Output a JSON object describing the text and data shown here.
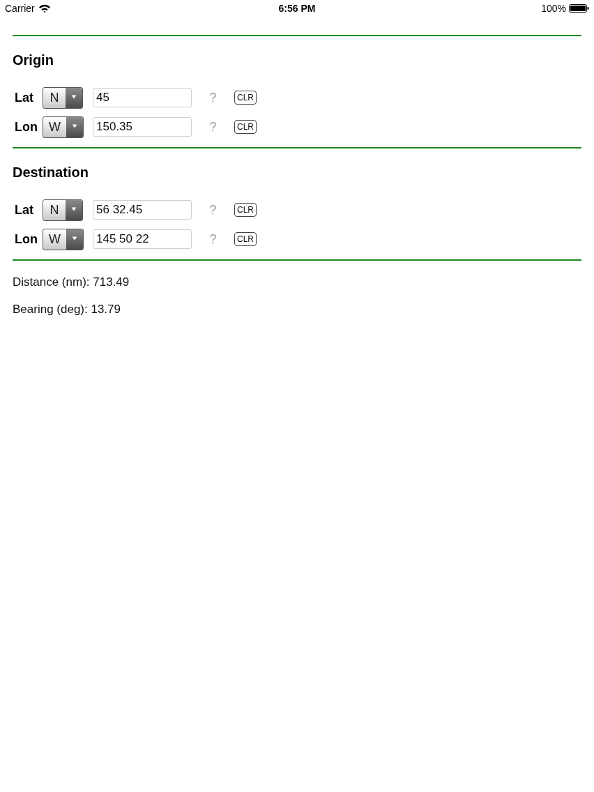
{
  "status_bar": {
    "carrier": "Carrier",
    "time": "6:56 PM",
    "battery": "100%"
  },
  "sections": [
    {
      "title": "Origin",
      "rows": [
        {
          "label": "Lat",
          "hemisphere": "N",
          "value": "45",
          "help": "?",
          "clear": "CLR"
        },
        {
          "label": "Lon",
          "hemisphere": "W",
          "value": "150.35",
          "help": "?",
          "clear": "CLR"
        }
      ]
    },
    {
      "title": "Destination",
      "rows": [
        {
          "label": "Lat",
          "hemisphere": "N",
          "value": "56 32.45",
          "help": "?",
          "clear": "CLR"
        },
        {
          "label": "Lon",
          "hemisphere": "W",
          "value": "145 50 22",
          "help": "?",
          "clear": "CLR"
        }
      ]
    }
  ],
  "results": [
    "Distance (nm): 713.49",
    "Bearing (deg): 13.79"
  ]
}
